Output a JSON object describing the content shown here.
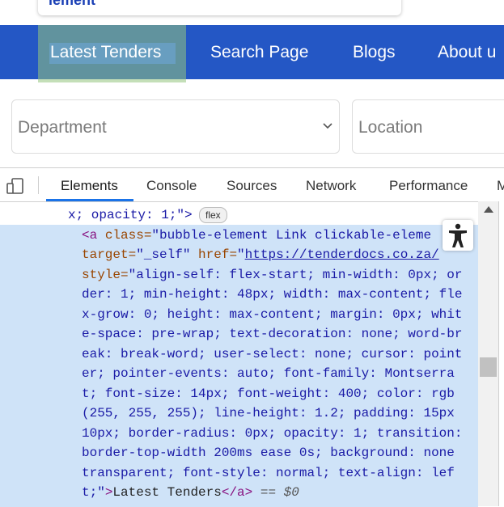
{
  "tooltip": {
    "text": "lement"
  },
  "nav": {
    "items": [
      "Latest Tenders",
      "Search Page",
      "Blogs",
      "About u"
    ]
  },
  "filters": {
    "department_placeholder": "Department",
    "location_placeholder": "Location"
  },
  "devtools": {
    "tabs": [
      "Elements",
      "Console",
      "Sources",
      "Network",
      "Performance",
      "M"
    ],
    "active_tab": "Elements",
    "flex_badge": "flex",
    "code_lines": {
      "l0": "x; opacity: 1;\">",
      "l1_tag_open": "<a ",
      "l1_attr": "class=",
      "l1_val": "\"bubble-element Link clickable-eleme",
      "l2_attr": "target=",
      "l2_val": "\"_self\"",
      "l2_attr2": " href=",
      "l2_q": "\"",
      "l2_link": "https://tenderdocs.co.za/",
      "l3_attr": "style=",
      "l3_val": "\"align-self: flex-start; min-width: 0px; or",
      "l4": "der: 1; min-height: 48px; width: max-content; fle",
      "l5": "x-grow: 0; height: max-content; margin: 0px; whit",
      "l6": "e-space: pre-wrap; text-decoration: none; word-br",
      "l7": "eak: break-word; user-select: none; cursor: point",
      "l8": "er; pointer-events: auto; font-family: Montserra",
      "l9": "t; font-size: 14px; font-weight: 400; color: rgb",
      "l10": "(255, 255, 255); line-height: 1.2; padding: 15px",
      "l11": "10px; border-radius: 0px; opacity: 1; transition:",
      "l12": "border-top-width 200ms ease 0s; background: none",
      "l13": "transparent; font-style: normal; text-align: lef",
      "l14_val": "t;\"",
      "l14_gt": ">",
      "l14_text": "Latest Tenders",
      "l14_close": "</a>",
      "l14_eq": " == ",
      "l14_dollar": "$0"
    }
  },
  "colors": {
    "nav_bg": "#2457c5",
    "selection_bg": "#cfe3f8",
    "tab_underline": "#1a73e8"
  }
}
